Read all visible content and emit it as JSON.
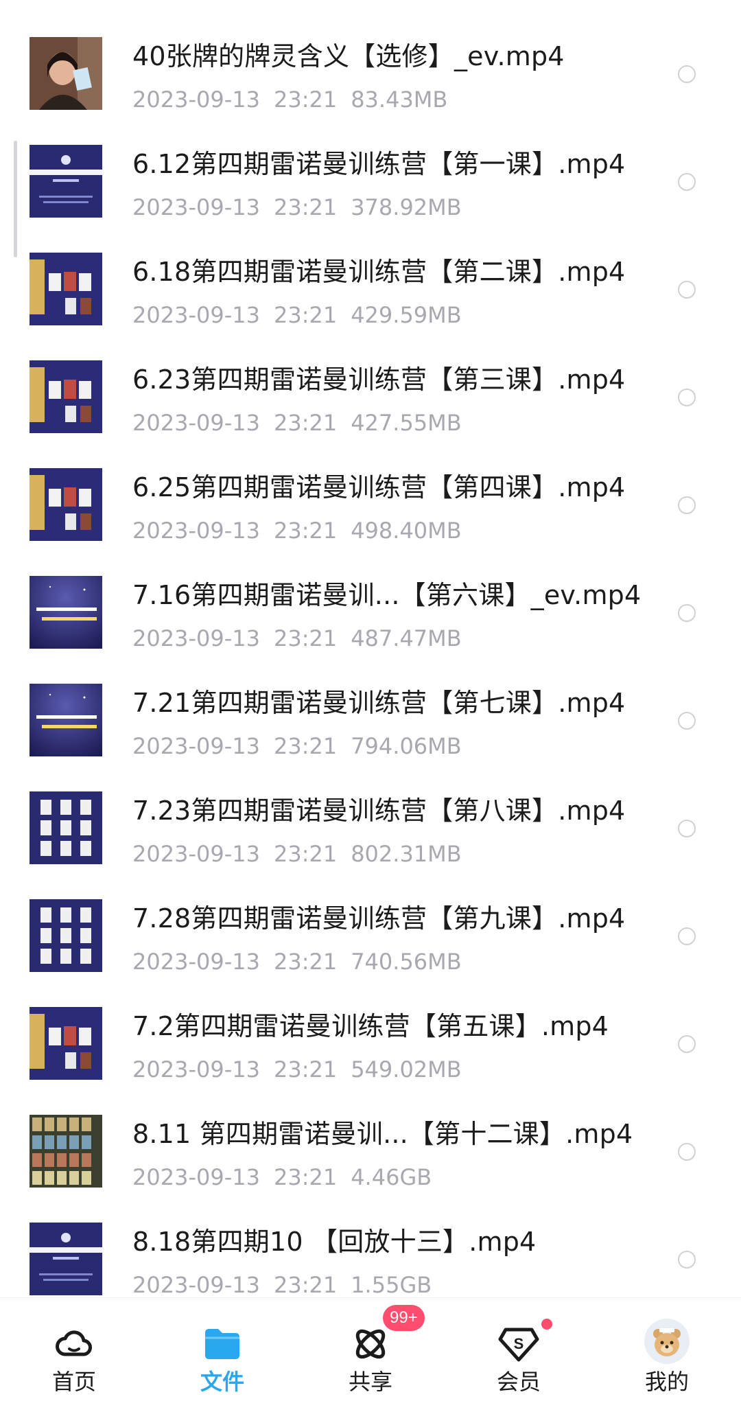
{
  "files": [
    {
      "name": "40张牌的牌灵含义【选修】_ev.mp4",
      "date": "2023-09-13",
      "time": "23:21",
      "size": "83.43MB",
      "thumb": "person-photo"
    },
    {
      "name": "6.12第四期雷诺曼训练营【第一课】.mp4",
      "date": "2023-09-13",
      "time": "23:21",
      "size": "378.92MB",
      "thumb": "title-slide"
    },
    {
      "name": "6.18第四期雷诺曼训练营【第二课】.mp4",
      "date": "2023-09-13",
      "time": "23:21",
      "size": "429.59MB",
      "thumb": "cards-slide"
    },
    {
      "name": "6.23第四期雷诺曼训练营【第三课】.mp4",
      "date": "2023-09-13",
      "time": "23:21",
      "size": "427.55MB",
      "thumb": "cards-slide"
    },
    {
      "name": "6.25第四期雷诺曼训练营【第四课】.mp4",
      "date": "2023-09-13",
      "time": "23:21",
      "size": "498.40MB",
      "thumb": "cards-slide"
    },
    {
      "name": "7.16第四期雷诺曼训...【第六课】_ev.mp4",
      "date": "2023-09-13",
      "time": "23:21",
      "size": "487.47MB",
      "thumb": "text-slide"
    },
    {
      "name": "7.21第四期雷诺曼训练营【第七课】.mp4",
      "date": "2023-09-13",
      "time": "23:21",
      "size": "794.06MB",
      "thumb": "text-slide"
    },
    {
      "name": "7.23第四期雷诺曼训练营【第八课】.mp4",
      "date": "2023-09-13",
      "time": "23:21",
      "size": "802.31MB",
      "thumb": "grid-slide"
    },
    {
      "name": "7.28第四期雷诺曼训练营【第九课】.mp4",
      "date": "2023-09-13",
      "time": "23:21",
      "size": "740.56MB",
      "thumb": "grid-slide"
    },
    {
      "name": "7.2第四期雷诺曼训练营【第五课】.mp4",
      "date": "2023-09-13",
      "time": "23:21",
      "size": "549.02MB",
      "thumb": "cards-slide"
    },
    {
      "name": "8.11 第四期雷诺曼训...【第十二课】.mp4",
      "date": "2023-09-13",
      "time": "23:21",
      "size": "4.46GB",
      "thumb": "card-spread"
    },
    {
      "name": "8.18第四期10 【回放十三】.mp4",
      "date": "2023-09-13",
      "time": "23:21",
      "size": "1.55GB",
      "thumb": "title-slide"
    }
  ],
  "tabbar": {
    "tabs": [
      {
        "label": "首页",
        "icon": "cloud-icon",
        "active": false
      },
      {
        "label": "文件",
        "icon": "folder-icon",
        "active": true
      },
      {
        "label": "共享",
        "icon": "share-orbit-icon",
        "active": false,
        "badge": "99+"
      },
      {
        "label": "会员",
        "icon": "vip-diamond-icon",
        "active": false,
        "dot": true
      },
      {
        "label": "我的",
        "icon": "avatar",
        "active": false
      }
    ]
  },
  "colors": {
    "accent": "#2aa8ef",
    "badge": "#ff4d6d",
    "meta_text": "#a7a9af",
    "thumb_bg": "#2b2a6e"
  }
}
